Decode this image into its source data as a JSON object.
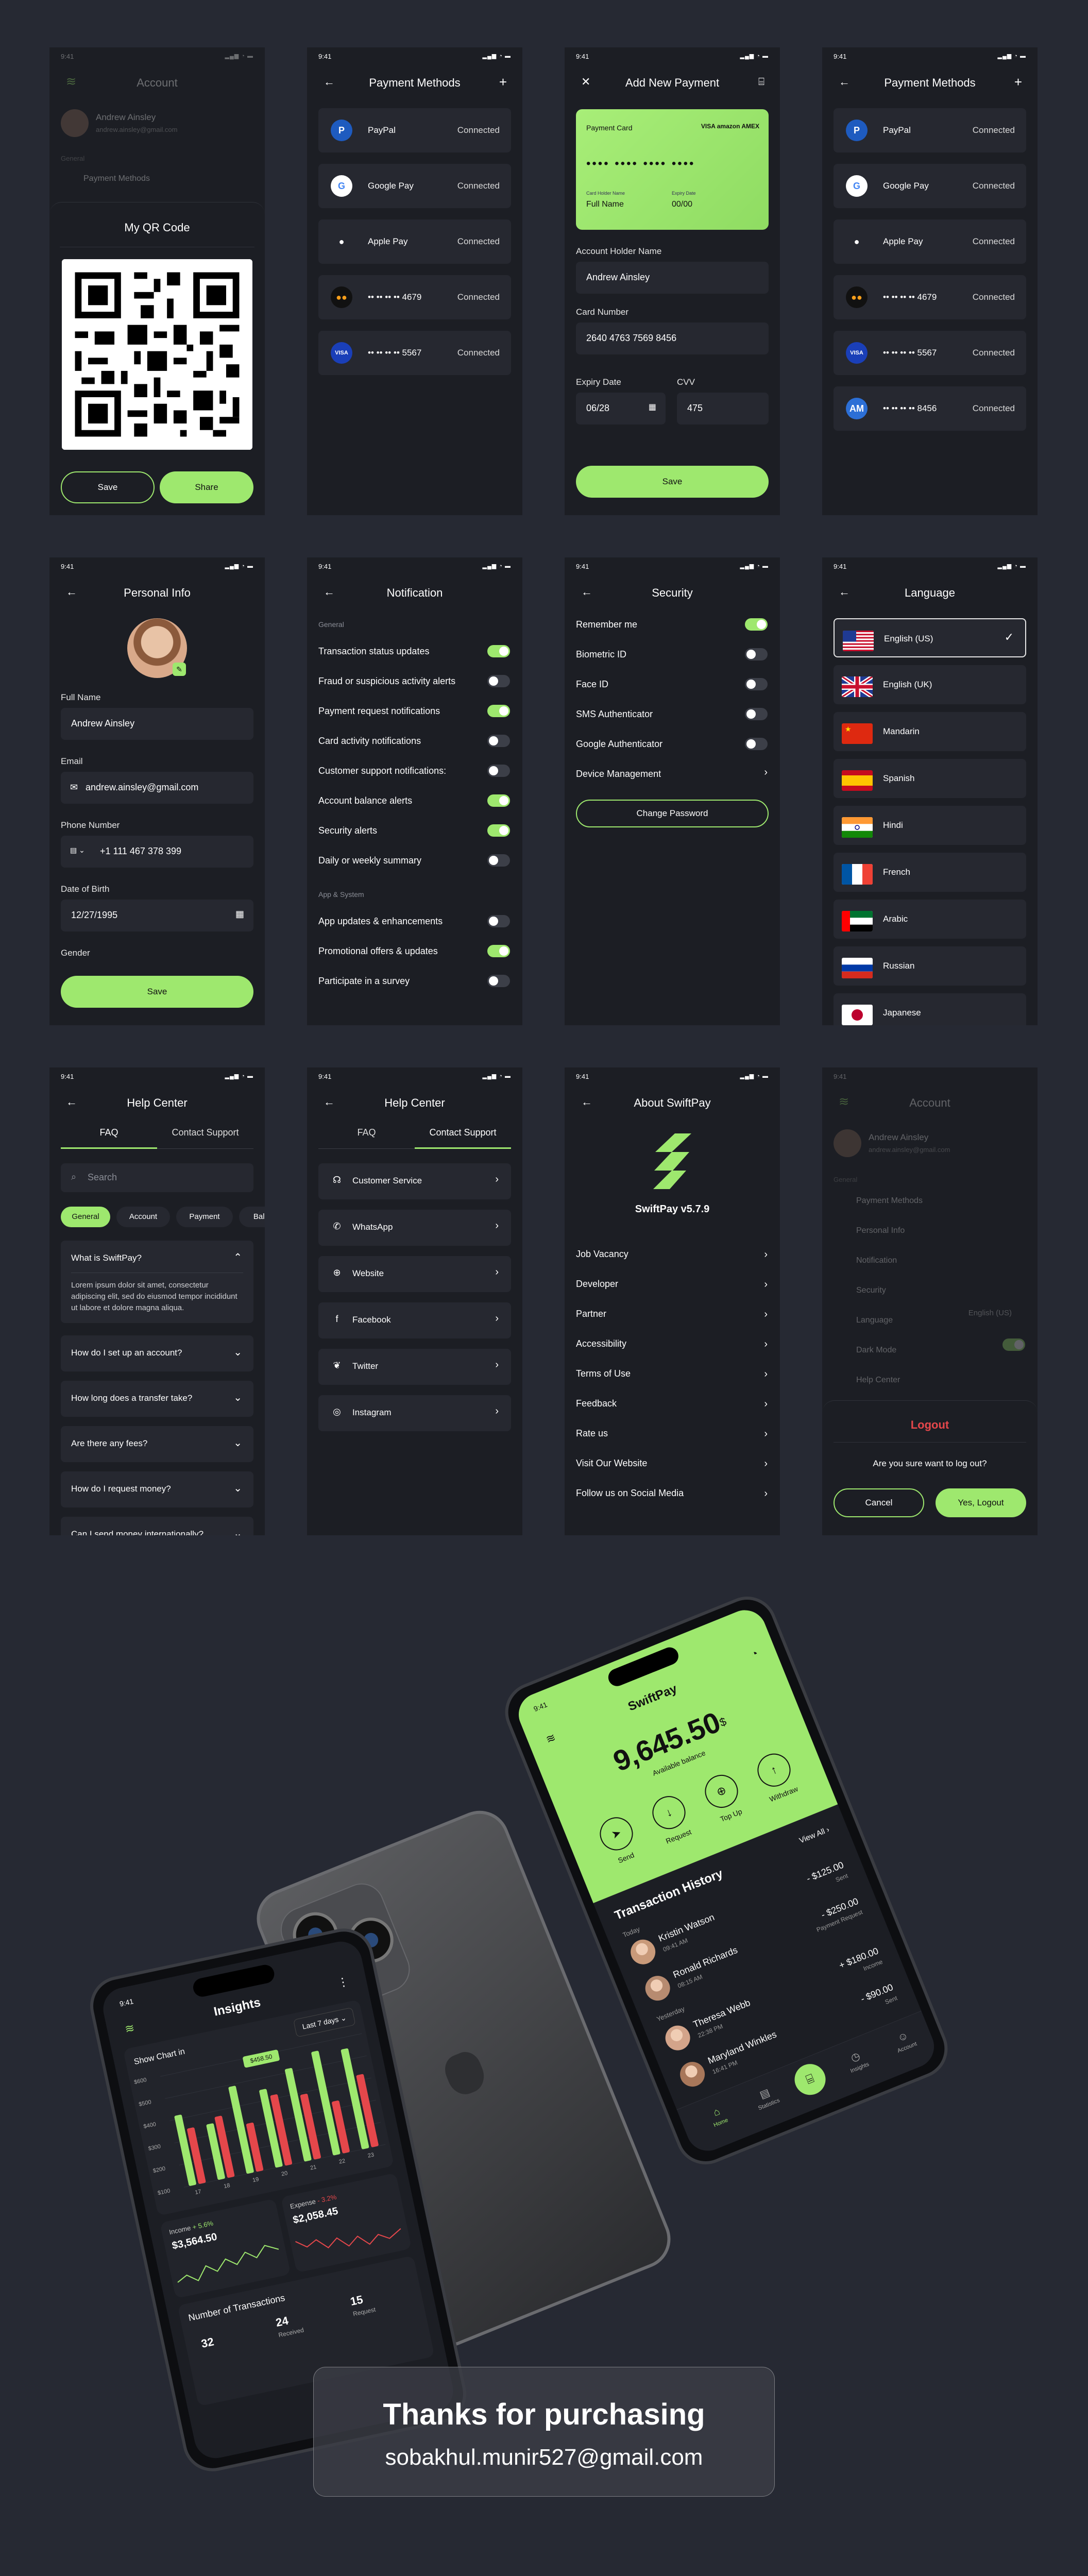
{
  "status_time": "9:41",
  "qr_screen": {
    "bg_title": "Account",
    "bg_name": "Andrew Ainsley",
    "bg_email": "andrew.ainsley@gmail.com",
    "bg_section": "General",
    "bg_item": "Payment Methods",
    "title": "My QR Code",
    "save": "Save",
    "share": "Share"
  },
  "payment_methods": {
    "title": "Payment Methods",
    "items": [
      {
        "name": "PayPal",
        "status": "Connected",
        "icon": "paypal-icon"
      },
      {
        "name": "Google Pay",
        "status": "Connected",
        "icon": "google-pay-icon"
      },
      {
        "name": "Apple Pay",
        "status": "Connected",
        "icon": "apple-pay-icon"
      },
      {
        "name": "•• •• •• •• 4679",
        "status": "Connected",
        "icon": "mastercard-icon"
      },
      {
        "name": "•• •• •• •• 5567",
        "status": "Connected",
        "icon": "visa-icon"
      }
    ],
    "extra_item": {
      "name": "•• •• •• •• 8456",
      "status": "Connected",
      "icon": "amex-icon"
    }
  },
  "add_payment": {
    "title": "Add New Payment",
    "card_label": "Payment Card",
    "card_brands": "VISA  amazon  AMEX",
    "card_number_mask": "•••• •••• •••• ••••",
    "card_holder_caption": "Card Holder Name",
    "card_expiry_caption": "Expiry Date",
    "card_holder": "Full Name",
    "card_expiry": "00/00",
    "holder_label": "Account Holder Name",
    "holder_value": "Andrew Ainsley",
    "number_label": "Card Number",
    "number_value": "2640 4763 7569 8456",
    "expiry_label": "Expiry Date",
    "expiry_value": "06/28",
    "cvv_label": "CVV",
    "cvv_value": "475",
    "save": "Save"
  },
  "personal_info": {
    "title": "Personal Info",
    "full_name_label": "Full Name",
    "full_name": "Andrew Ainsley",
    "email_label": "Email",
    "email": "andrew.ainsley@gmail.com",
    "phone_label": "Phone Number",
    "phone": "+1 111 467 378 399",
    "dob_label": "Date of Birth",
    "dob": "12/27/1995",
    "gender_label": "Gender",
    "save": "Save"
  },
  "notification": {
    "title": "Notification",
    "general_label": "General",
    "general": [
      {
        "label": "Transaction status updates",
        "on": true
      },
      {
        "label": "Fraud or suspicious activity alerts",
        "on": false
      },
      {
        "label": "Payment request notifications",
        "on": true
      },
      {
        "label": "Card activity notifications",
        "on": false
      },
      {
        "label": "Customer support notifications:",
        "on": false
      },
      {
        "label": "Account balance alerts",
        "on": true
      },
      {
        "label": "Security alerts",
        "on": true
      },
      {
        "label": "Daily or weekly summary",
        "on": false
      }
    ],
    "system_label": "App & System",
    "system": [
      {
        "label": "App updates & enhancements",
        "on": false
      },
      {
        "label": "Promotional offers & updates",
        "on": true
      },
      {
        "label": "Participate in a survey",
        "on": false
      }
    ]
  },
  "security": {
    "title": "Security",
    "items": [
      {
        "label": "Remember me",
        "on": true
      },
      {
        "label": "Biometric ID",
        "on": false
      },
      {
        "label": "Face ID",
        "on": false
      },
      {
        "label": "SMS Authenticator",
        "on": false
      },
      {
        "label": "Google Authenticator",
        "on": false
      }
    ],
    "device_management": "Device Management",
    "change_password": "Change Password"
  },
  "language": {
    "title": "Language",
    "items": [
      "English (US)",
      "English (UK)",
      "Mandarin",
      "Spanish",
      "Hindi",
      "French",
      "Arabic",
      "Russian",
      "Japanese"
    ]
  },
  "help_faq": {
    "title": "Help Center",
    "tab_faq": "FAQ",
    "tab_contact": "Contact Support",
    "search_placeholder": "Search",
    "chips": [
      "General",
      "Account",
      "Payment",
      "Balance"
    ],
    "open_q": "What is SwiftPay?",
    "open_a": "Lorem ipsum dolor sit amet, consectetur adipiscing elit, sed do eiusmod tempor incididunt ut labore et dolore magna aliqua.",
    "questions": [
      "How do I set up an account?",
      "How long does a transfer take?",
      "Are there any fees?",
      "How do I request money?",
      "Can I send money internationally?"
    ]
  },
  "help_contact": {
    "title": "Help Center",
    "tab_faq": "FAQ",
    "tab_contact": "Contact Support",
    "items": [
      {
        "label": "Customer Service",
        "icon": "headset-icon"
      },
      {
        "label": "WhatsApp",
        "icon": "whatsapp-icon"
      },
      {
        "label": "Website",
        "icon": "globe-icon"
      },
      {
        "label": "Facebook",
        "icon": "facebook-icon"
      },
      {
        "label": "Twitter",
        "icon": "twitter-icon"
      },
      {
        "label": "Instagram",
        "icon": "instagram-icon"
      }
    ]
  },
  "about": {
    "title": "About SwiftPay",
    "version": "SwiftPay v5.7.9",
    "items": [
      "Job Vacancy",
      "Developer",
      "Partner",
      "Accessibility",
      "Terms of Use",
      "Feedback",
      "Rate us",
      "Visit Our Website",
      "Follow us on Social Media"
    ]
  },
  "logout_screen": {
    "bg_title": "Account",
    "bg_name": "Andrew Ainsley",
    "bg_email": "andrew.ainsley@gmail.com",
    "bg_section": "General",
    "bg_items": [
      "Payment Methods",
      "Personal Info",
      "Notification",
      "Security",
      "Language",
      "Dark Mode",
      "Help Center"
    ],
    "bg_language_value": "English (US)",
    "title": "Logout",
    "message": "Are you sure want to log out?",
    "cancel": "Cancel",
    "confirm": "Yes, Logout"
  },
  "mockup_home": {
    "app_name": "SwiftPay",
    "balance": "9,645.50",
    "currency": "$",
    "balance_label": "Available balance",
    "actions": [
      "Send",
      "Request",
      "Top Up",
      "Withdraw"
    ],
    "history_title": "Transaction History",
    "view_all": "View All",
    "group_today": "Today",
    "group_yesterday": "Yesterday",
    "transactions": [
      {
        "name": "Kristin Watson",
        "time": "09:41 AM",
        "amount": "- $125.00",
        "type": "Sent"
      },
      {
        "name": "Ronald Richards",
        "time": "08:15 AM",
        "amount": "- $250.00",
        "type": "Payment Request"
      },
      {
        "name": "Theresa Webb",
        "time": "22:38 PM",
        "amount": "+ $180.00",
        "type": "Income"
      },
      {
        "name": "Maryland Winkles",
        "time": "16:41 PM",
        "amount": "- $90.00",
        "type": "Sent"
      }
    ],
    "nav": [
      "Home",
      "Statistics",
      "Insights",
      "Account"
    ]
  },
  "mockup_insights": {
    "title": "Insights",
    "chart_title": "Show Chart in",
    "period": "Last 7 days",
    "tooltip": "$458.50",
    "income_label": "Income",
    "income_change": "+ 5.6%",
    "income_value": "$3,564.50",
    "expense_label": "Expense",
    "expense_change": "- 3.2%",
    "expense_value": "$2,058.45",
    "transactions_title": "Number of Transactions",
    "count_sent": "32",
    "count_received": "24",
    "count_received_label": "Received",
    "count_request": "15",
    "count_request_label": "Request"
  },
  "chart_data": {
    "type": "bar",
    "categories": [
      "17",
      "18",
      "19",
      "20",
      "21",
      "22",
      "23"
    ],
    "yticks": [
      "$600",
      "$500",
      "$400",
      "$300",
      "$200",
      "$100"
    ],
    "ylim": [
      0,
      600
    ],
    "series": [],
    "values_green": [
      380,
      300,
      470,
      420,
      500,
      560,
      540
    ],
    "values_red": [
      300,
      330,
      260,
      380,
      350,
      280,
      390
    ],
    "colors": {
      "green": "#9EE86E",
      "red": "#E5474B"
    }
  },
  "footer": {
    "title": "Thanks for purchasing",
    "email": "sobakhul.munir527@gmail.com"
  },
  "colors": {
    "accent": "#9EE86E",
    "bg": "#262933",
    "screen": "#1C1E24",
    "row": "#262830",
    "danger": "#E5474B"
  }
}
